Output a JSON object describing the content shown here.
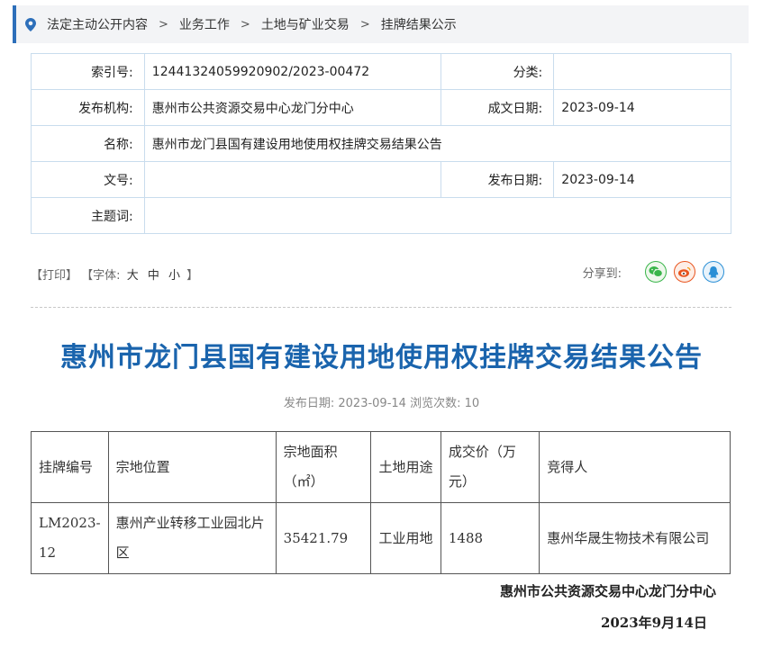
{
  "breadcrumb": {
    "items": [
      "法定主动公开内容",
      "业务工作",
      "土地与矿业交易",
      "挂牌结果公示"
    ],
    "separator": ">"
  },
  "meta": {
    "index_label": "索引号:",
    "index_value": "12441324059920902/2023-00472",
    "category_label": "分类:",
    "category_value": "",
    "publisher_label": "发布机构:",
    "publisher_value": "惠州市公共资源交易中心龙门分中心",
    "written_date_label": "成文日期:",
    "written_date_value": "2023-09-14",
    "name_label": "名称:",
    "name_value": "惠州市龙门县国有建设用地使用权挂牌交易结果公告",
    "doc_no_label": "文号:",
    "doc_no_value": "",
    "publish_date_label": "发布日期:",
    "publish_date_value": "2023-09-14",
    "subject_label": "主题词:",
    "subject_value": ""
  },
  "toolbar": {
    "print_label": "【打印】",
    "font_label": "【字体:",
    "font_large": "大",
    "font_medium": "中",
    "font_small": "小",
    "font_close": "】",
    "share_label": "分享到:"
  },
  "article": {
    "title": "惠州市龙门县国有建设用地使用权挂牌交易结果公告",
    "publish_info": "发布日期: 2023-09-14 浏览次数: 10"
  },
  "result_table": {
    "headers": [
      "挂牌编号",
      "宗地位置",
      "宗地面积（㎡）",
      "土地用途",
      "成交价（万元）",
      "竞得人"
    ],
    "rows": [
      [
        "LM2023-12",
        "惠州产业转移工业园北片区",
        "35421.79",
        "工业用地",
        "1488",
        "惠州华晟生物技术有限公司"
      ]
    ]
  },
  "footer": {
    "signature": "惠州市公共资源交易中心龙门分中心",
    "date": "2023年9月14日"
  },
  "colors": {
    "accent": "#2d6fba",
    "title": "#1a64ad",
    "wechat": "#39b54a",
    "weibo": "#e8541e",
    "qq": "#2a8fd6"
  }
}
